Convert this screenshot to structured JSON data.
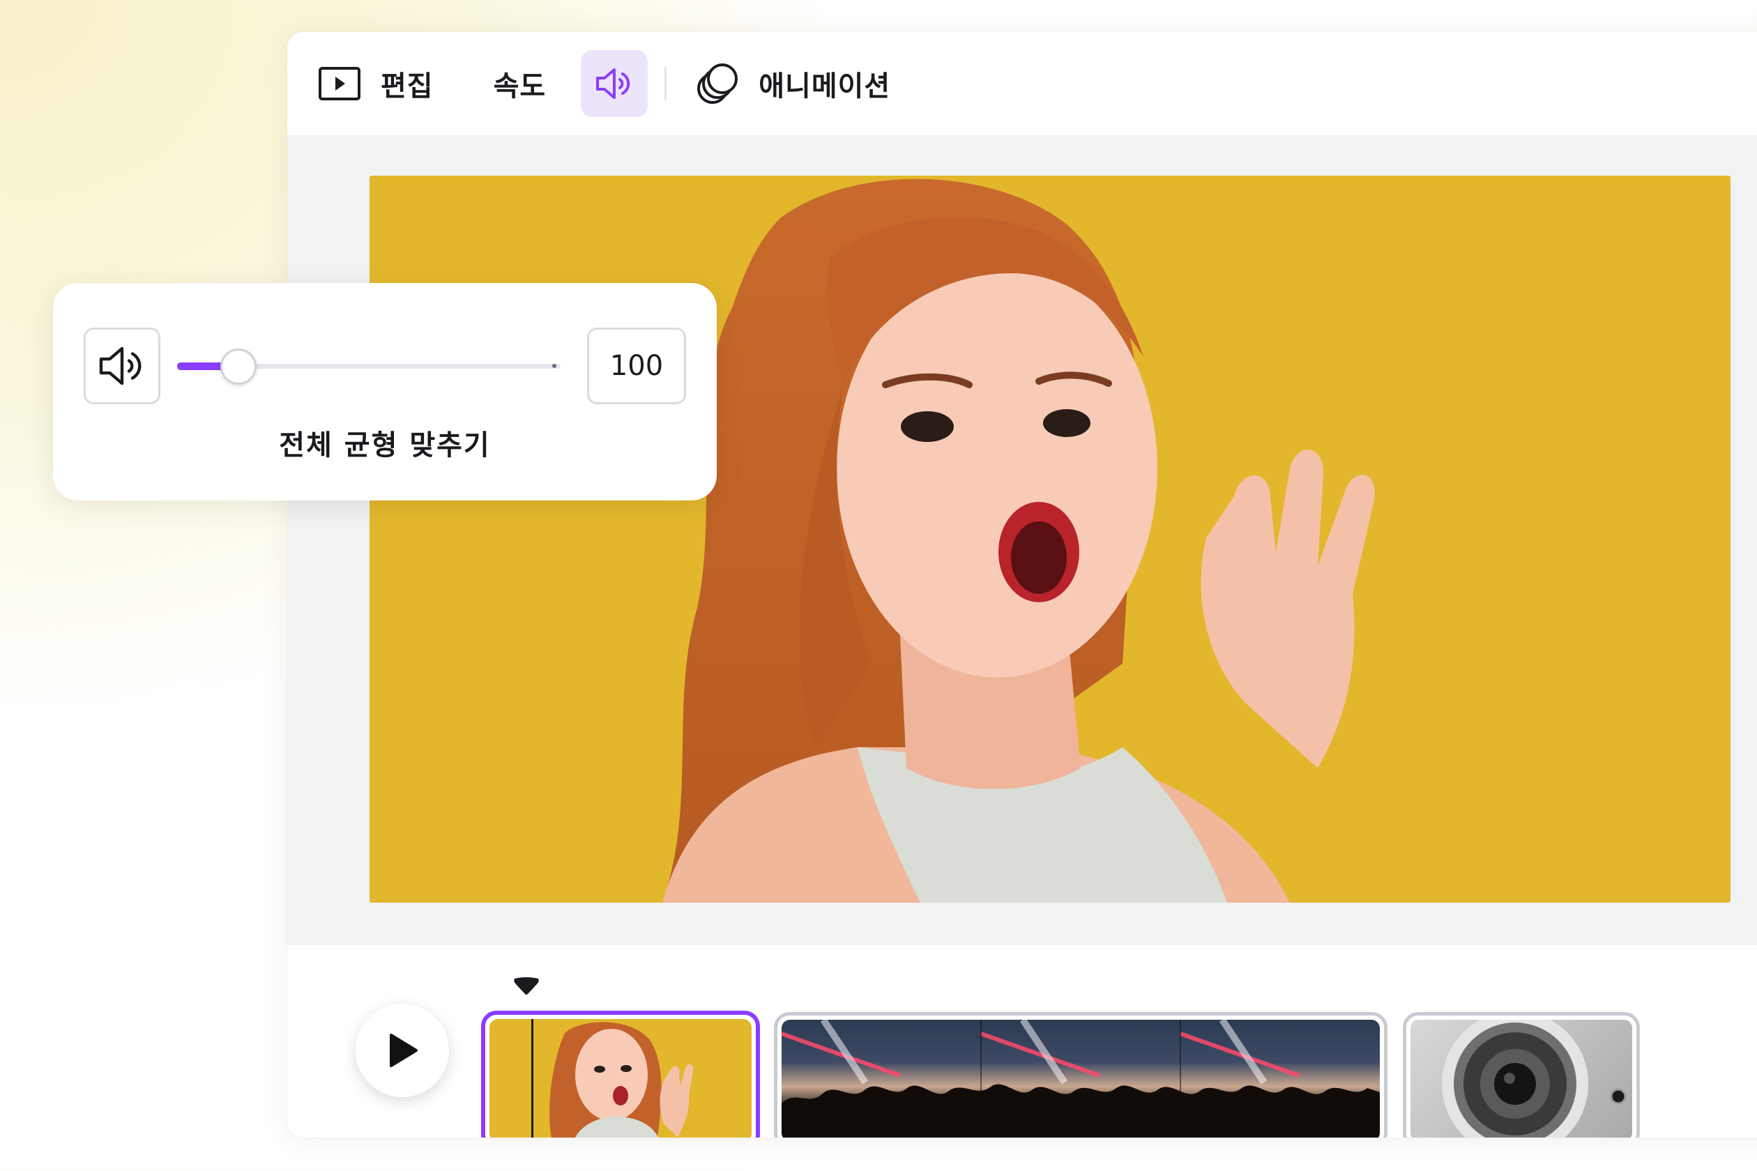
{
  "toolbar": {
    "items": [
      {
        "label": "편집",
        "icon": "play-square-icon"
      },
      {
        "label": "속도"
      },
      {
        "icon": "speaker-icon",
        "active": true
      },
      {
        "label": "애니메이션",
        "icon": "animation-circles-icon"
      }
    ]
  },
  "volume_popover": {
    "value": "100",
    "level_fraction": 0.16,
    "balance_label": "전체 균형 맞추기"
  },
  "timeline": {
    "clips": [
      {
        "content": "woman-surprised-yellow-background",
        "selected": true
      },
      {
        "content": "concert-crowd-lights"
      },
      {
        "content": "loudspeaker-closeup"
      }
    ]
  },
  "colors": {
    "accent": "#8b3dff",
    "accent_soft": "#ece4fb",
    "preview_background": "#e2b72c"
  }
}
